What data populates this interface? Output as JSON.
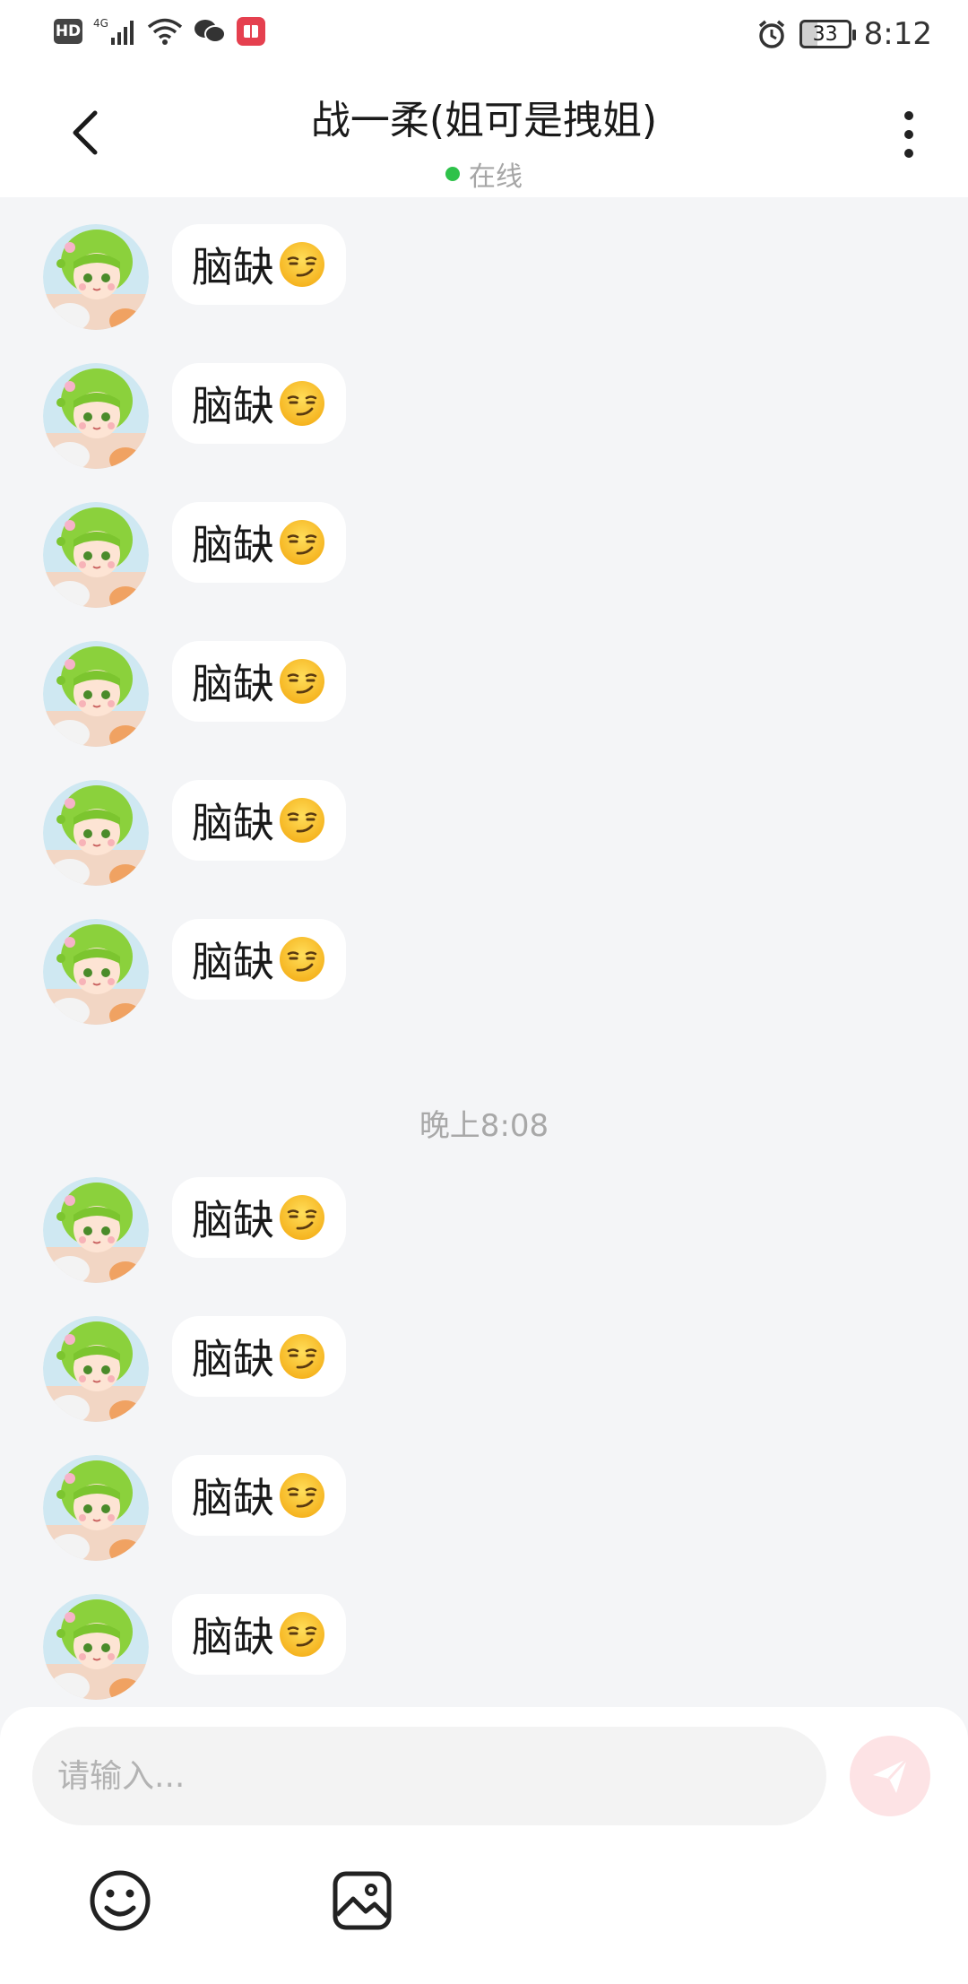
{
  "status_bar": {
    "left_icons": [
      "hd-icon",
      "signal-4g-icon",
      "wifi-icon",
      "wechat-icon",
      "app-notification-icon"
    ],
    "hd_label": "HD",
    "network_label": "4G",
    "right_icons": [
      "alarm-icon",
      "battery-icon"
    ],
    "battery_level": "33",
    "time": "8:12"
  },
  "header": {
    "back_icon": "chevron-left-icon",
    "title": "战一柔(姐可是拽姐)",
    "status_text": "在线",
    "status_color": "#2ec24a",
    "more_icon": "vertical-dots-icon"
  },
  "chat": {
    "messages_before": [
      {
        "text": "脑缺",
        "emoji": "smirk-emoji"
      },
      {
        "text": "脑缺",
        "emoji": "smirk-emoji"
      },
      {
        "text": "脑缺",
        "emoji": "smirk-emoji"
      },
      {
        "text": "脑缺",
        "emoji": "smirk-emoji"
      },
      {
        "text": "脑缺",
        "emoji": "smirk-emoji"
      },
      {
        "text": "脑缺",
        "emoji": "smirk-emoji"
      }
    ],
    "timestamp": "晚上8:08",
    "messages_after": [
      {
        "text": "脑缺",
        "emoji": "smirk-emoji"
      },
      {
        "text": "脑缺",
        "emoji": "smirk-emoji"
      },
      {
        "text": "脑缺",
        "emoji": "smirk-emoji"
      },
      {
        "text": "脑缺",
        "emoji": "smirk-emoji"
      }
    ]
  },
  "composer": {
    "placeholder": "请输入...",
    "value": "",
    "send_icon": "paper-plane-icon",
    "send_color": "#fde3e5",
    "tools": [
      "smiley-icon",
      "image-icon"
    ]
  }
}
